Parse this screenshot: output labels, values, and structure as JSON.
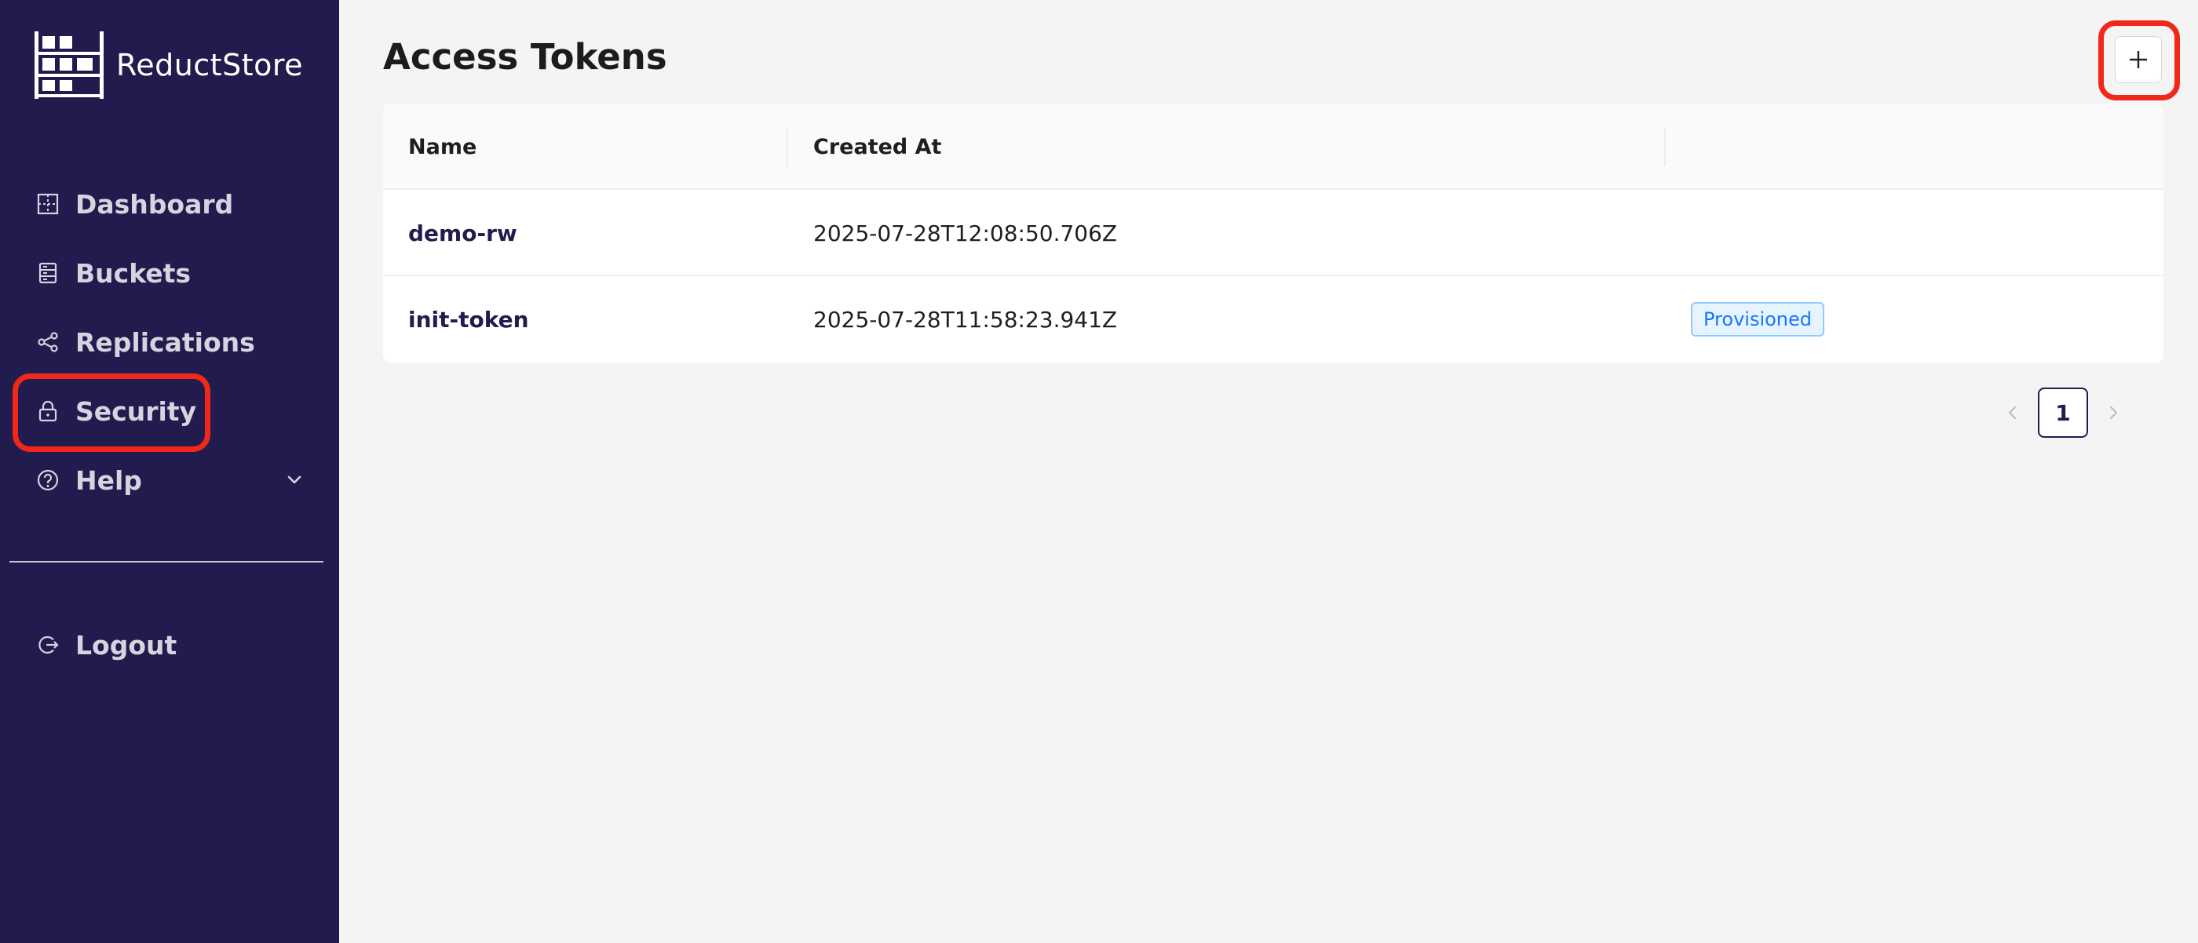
{
  "app": {
    "name": "ReductStore"
  },
  "sidebar": {
    "items": [
      {
        "label": "Dashboard",
        "icon": "dashboard-icon"
      },
      {
        "label": "Buckets",
        "icon": "bucket-icon"
      },
      {
        "label": "Replications",
        "icon": "share-icon"
      },
      {
        "label": "Security",
        "icon": "lock-icon"
      },
      {
        "label": "Help",
        "icon": "question-circle-icon"
      }
    ],
    "logout_label": "Logout"
  },
  "page": {
    "title": "Access Tokens",
    "add_icon": "plus-icon"
  },
  "table": {
    "columns": [
      "Name",
      "Created At",
      ""
    ],
    "rows": [
      {
        "name": "demo-rw",
        "created_at": "2025-07-28T12:08:50.706Z",
        "tag": ""
      },
      {
        "name": "init-token",
        "created_at": "2025-07-28T11:58:23.941Z",
        "tag": "Provisioned"
      }
    ]
  },
  "pagination": {
    "current_page": "1"
  },
  "colors": {
    "sidebar_bg": "#221b4e",
    "highlight": "#f0281a",
    "badge": "#1677ff"
  }
}
